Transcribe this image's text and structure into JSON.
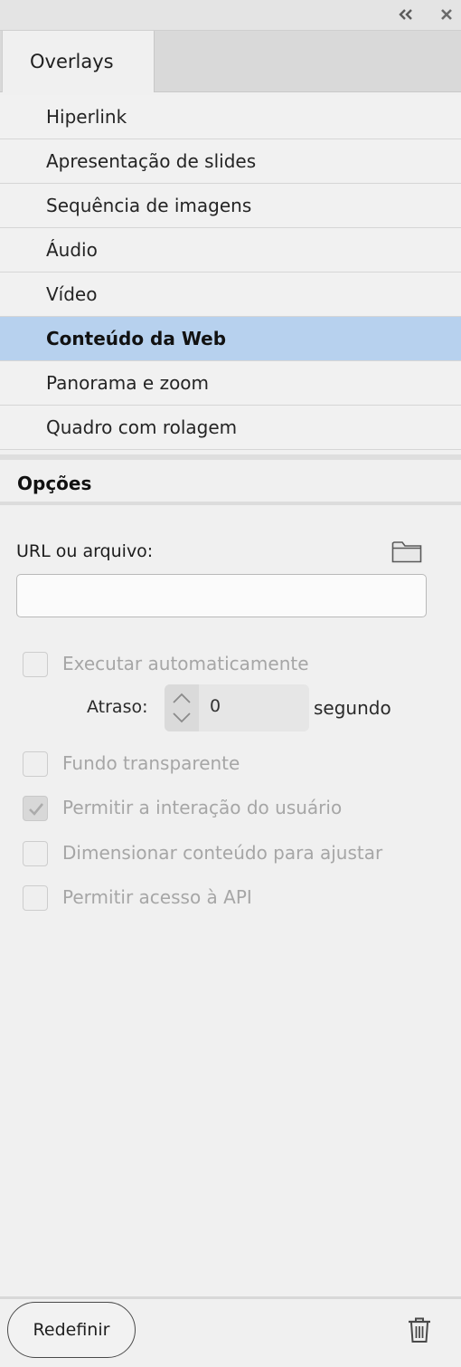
{
  "window": {
    "collapse_icon": "double-chevron-left-icon",
    "close_icon": "close-icon"
  },
  "tabs": [
    {
      "label": "Overlays",
      "active": true
    }
  ],
  "overlay_list": [
    {
      "label": "Hiperlink",
      "selected": false
    },
    {
      "label": "Apresentação de slides",
      "selected": false
    },
    {
      "label": "Sequência de imagens",
      "selected": false
    },
    {
      "label": "Áudio",
      "selected": false
    },
    {
      "label": "Vídeo",
      "selected": false
    },
    {
      "label": "Conteúdo da Web",
      "selected": true
    },
    {
      "label": "Panorama e zoom",
      "selected": false
    },
    {
      "label": "Quadro com rolagem",
      "selected": false
    }
  ],
  "options": {
    "header": "Opções",
    "url_label": "URL ou arquivo:",
    "url_value": "",
    "browse_icon": "folder-icon",
    "autoplay": {
      "label": "Executar automaticamente",
      "checked": false,
      "enabled": false
    },
    "delay": {
      "label": "Atraso:",
      "value": "0",
      "unit": "segundo"
    },
    "transparent_bg": {
      "label": "Fundo transparente",
      "checked": false,
      "enabled": false
    },
    "allow_interaction": {
      "label": "Permitir a interação do usuário",
      "checked": true,
      "enabled": false
    },
    "scale_to_fit": {
      "label": "Dimensionar conteúdo para ajustar",
      "checked": false,
      "enabled": false
    },
    "allow_api": {
      "label": "Permitir acesso à API",
      "checked": false,
      "enabled": false
    }
  },
  "footer": {
    "reset_label": "Redefinir",
    "delete_icon": "trash-icon"
  },
  "colors": {
    "panel_bg": "#f0f0f0",
    "selected_bg": "#b7d1ee",
    "disabled_text": "#a6a6a6"
  }
}
